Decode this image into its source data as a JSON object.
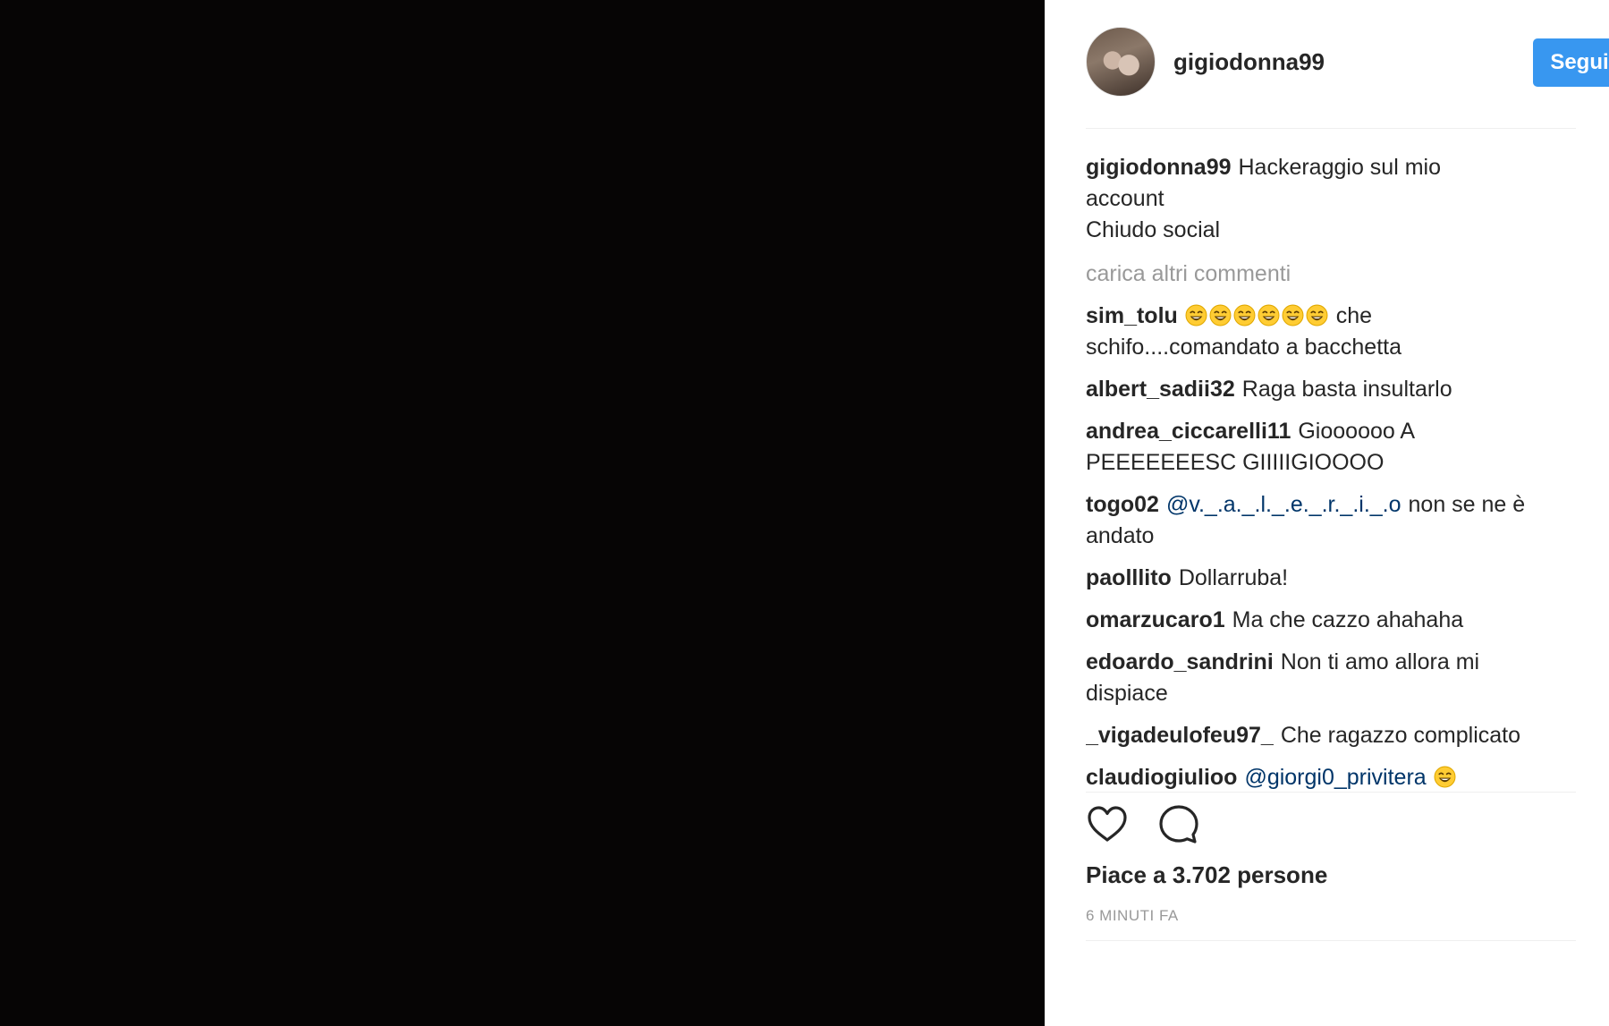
{
  "post": {
    "username": "gigiodonna99",
    "follow_label": "Segui",
    "caption_user": "gigiodonna99",
    "caption_lines": [
      "Hackeraggio sul mio",
      "account",
      "Chiudo social"
    ]
  },
  "load_more_label": "carica altri commenti",
  "comments": [
    {
      "user": "sim_tolu",
      "emoji_count": 6,
      "text_a": "che",
      "text_b": "schifo....comandato a bacchetta"
    },
    {
      "user": "albert_sadii32",
      "text_a": "Raga basta insultarlo"
    },
    {
      "user": "andrea_ciccarelli11",
      "text_a": "Gioooooo A",
      "text_b": "PEEEEEEESC GIIIIIGIOOOO"
    },
    {
      "user": "togo02",
      "mention": "@v._.a._.l._.e._.r._.i._.o",
      "text_a": "non se ne è",
      "text_b": "andato"
    },
    {
      "user": "paolllito",
      "text_a": "Dollarruba!"
    },
    {
      "user": "omarzucaro1",
      "text_a": "Ma che cazzo ahahaha"
    },
    {
      "user": "edoardo_sandrini",
      "text_a": "Non ti amo allora mi",
      "text_b": "dispiace"
    },
    {
      "user": "_vigadeulofeu97_",
      "text_a": "Che ragazzo complicato"
    },
    {
      "user": "claudiogiulioo",
      "mention": "@giorgi0_privitera",
      "emoji_count": 1
    }
  ],
  "likes_label": "Piace a 3.702 persone",
  "timestamp": "6 MINUTI FA",
  "icons": {
    "like": "heart-icon",
    "comment": "comment-icon",
    "emoji": "laughing-emoji-icon"
  },
  "colors": {
    "follow": "#3897f0",
    "mention": "#003569",
    "muted": "#999999",
    "media_bg": "#060505"
  }
}
